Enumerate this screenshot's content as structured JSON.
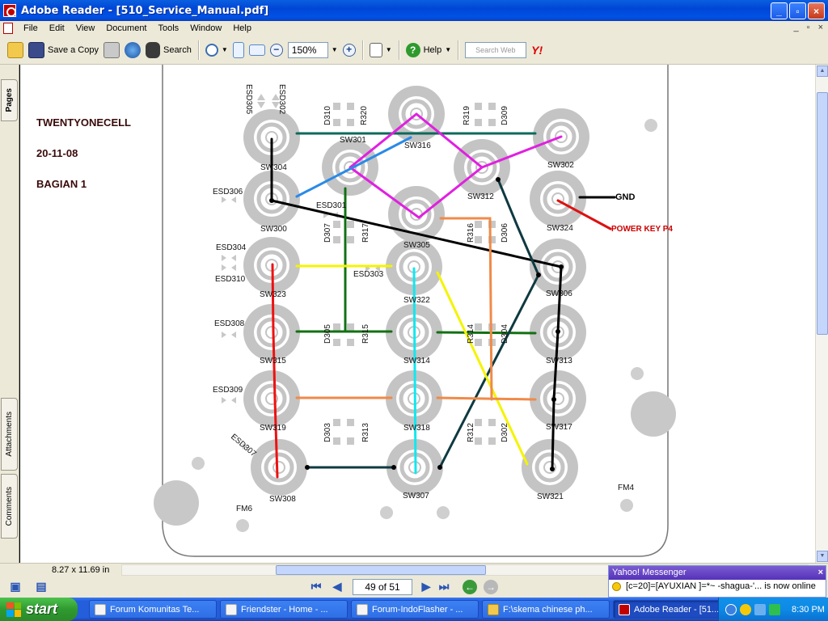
{
  "window": {
    "title": "Adobe Reader - [510_Service_Manual.pdf]",
    "minimize": "_",
    "maximize": "▫",
    "close": "×"
  },
  "menu": {
    "items": [
      "File",
      "Edit",
      "View",
      "Document",
      "Tools",
      "Window",
      "Help"
    ],
    "mdi": [
      "_",
      "▫",
      "×"
    ]
  },
  "toolbar": {
    "save_copy": "Save a Copy",
    "search": "Search",
    "zoom_value": "150%",
    "help": "Help",
    "search_web_placeholder": "Search Web",
    "yahoo_icon": "Y!"
  },
  "sidenav": {
    "tabs": [
      "Pages",
      "Attachments",
      "Comments"
    ]
  },
  "document": {
    "header_lines": [
      "TWENTYONECELL",
      "20-11-08",
      "BAGIAN 1"
    ],
    "gnd_label": "GND",
    "power_label": "POWER KEY P4",
    "switch_labels": [
      "SW304",
      "SW301",
      "SW316",
      "SW302",
      "SW300",
      "SW312",
      "SW324",
      "SW305",
      "SW323",
      "SW322",
      "SW306",
      "SW315",
      "SW314",
      "SW313",
      "SW319",
      "SW318",
      "SW317",
      "SW308",
      "SW307",
      "SW321"
    ],
    "esd_labels": [
      "ESD305",
      "ESD302",
      "ESD306",
      "ESD301",
      "ESD304",
      "ESD310",
      "ESD303",
      "ESD308",
      "ESD309",
      "ESD307"
    ],
    "part_labels": [
      "D310",
      "R320",
      "R319",
      "D309",
      "D307",
      "R317",
      "R316",
      "D306",
      "D305",
      "R315",
      "R314",
      "D304",
      "D303",
      "R313",
      "R312",
      "D302"
    ],
    "fm_labels": [
      "FM6",
      "FM4"
    ]
  },
  "status": {
    "page_size": "8.27 x 11.69 in"
  },
  "navigation": {
    "page_indicator": "49 of 51"
  },
  "notification": {
    "title": "Yahoo! Messenger",
    "message": "[c=20]=[AYUXIAN ]=*~ -shagua-'... is now online",
    "close": "×"
  },
  "taskbar": {
    "start": "start",
    "tasks": [
      "Forum Komunitas Te...",
      "Friendster - Home - ...",
      "Forum-IndoFlasher - ...",
      "F:\\skema chinese ph...",
      "Adobe Reader - [51..."
    ],
    "clock": "8:30 PM"
  },
  "colors": {
    "title_blue": "#0046d6",
    "chrome": "#ece9d8",
    "wire_magenta": "#e020e0",
    "wire_black": "#000000",
    "wire_red": "#ee1111",
    "wire_green": "#127012",
    "wire_cyan": "#11e8f0",
    "wire_yellow": "#f4f400",
    "wire_orange": "#f08a48",
    "wire_teal": "#0e3a40",
    "wire_blue": "#2a8ae8",
    "header_text": "#3a0a0a",
    "power_red": "#cc0000"
  }
}
